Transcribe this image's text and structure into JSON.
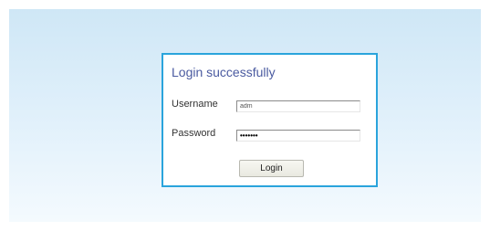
{
  "login": {
    "title": "Login successfully",
    "username_label": "Username",
    "username_value": "adm",
    "password_label": "Password",
    "password_value": "•••••••",
    "button_label": "Login"
  },
  "colors": {
    "border_accent": "#2aa4dc",
    "title_color": "#4a5aa0",
    "background_top": "#cfe7f6",
    "background_bottom": "#f4fafe"
  }
}
